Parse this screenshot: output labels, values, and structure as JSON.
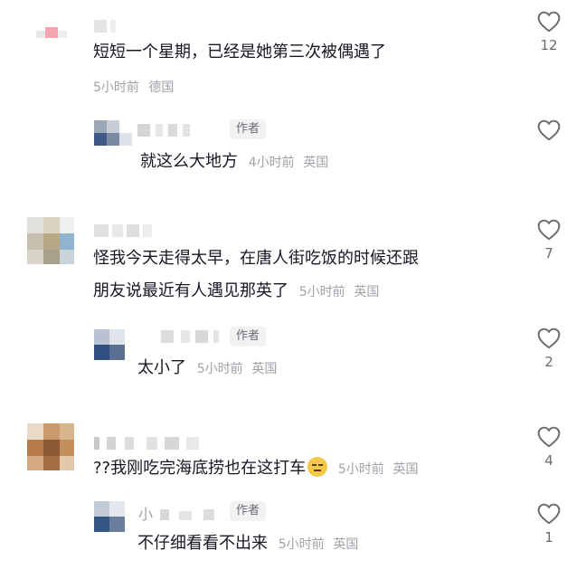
{
  "comments": [
    {
      "text": "短短一个星期，已经是她第三次被偶遇了",
      "time": "5小时前",
      "location": "德国",
      "likes": "12",
      "reply": {
        "badge": "作者",
        "text": "就这么大地方",
        "time": "4小时前",
        "location": "英国",
        "likes": ""
      }
    },
    {
      "text_lines": [
        "怪我今天走得太早，在唐人街吃饭的时候还跟",
        "朋友说最近有人遇见那英了"
      ],
      "time": "5小时前",
      "location": "英国",
      "likes": "7",
      "reply": {
        "badge": "作者",
        "text": "太小了",
        "time": "5小时前",
        "location": "英国",
        "likes": "2"
      }
    },
    {
      "text": "??我刚吃完海底捞也在这打车",
      "emoji": "expressionless-face-icon",
      "time": "5小时前",
      "location": "英国",
      "likes": "4",
      "reply": {
        "name_visible": "小",
        "badge": "作者",
        "text": "不仔细看看不出来",
        "time": "5小时前",
        "location": "英国",
        "likes": "1"
      }
    }
  ],
  "colors": {
    "text": "#161823",
    "meta": "#a1a2a8",
    "badge_bg": "#f2f2f4",
    "icon": "#6b6b70"
  }
}
